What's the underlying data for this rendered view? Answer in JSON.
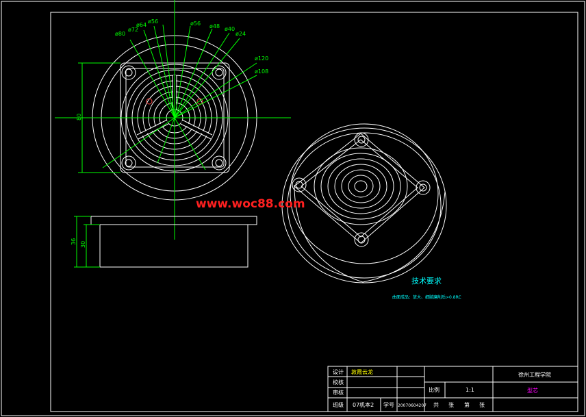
{
  "drawing": {
    "dimensions": {
      "d80": "ø80",
      "d72": "ø72",
      "d64": "ø64",
      "d56a": "ø56",
      "d56b": "ø56",
      "d48": "ø48",
      "d40": "ø40",
      "d24": "ø24",
      "d120": "ø120",
      "d108": "ø108",
      "h80": "80",
      "h36": "36",
      "h30": "30"
    },
    "watermark": "www.woc88.com",
    "tech_title": "技术要求",
    "tech_note": "曲面成品：放大、细腻磨削后>0.8RC"
  },
  "title_block": {
    "r1_label": "设计",
    "r1_value": "敦霞云龙",
    "r2_label": "校核",
    "r3_label": "审核",
    "r4_label": "班级",
    "r4_value": "07机本2",
    "r4_label2": "学号",
    "r4_value2": "20070604207",
    "scale_label": "比例",
    "scale_value": "1:1",
    "school": "徐州工程学院",
    "part_name": "型芯",
    "sheet_total": "共",
    "sheet_word": "张",
    "sheet_no": "第",
    "sheet_word2": "张"
  },
  "colors": {
    "geometry": "#ffffff",
    "dimension": "#00ff00",
    "watermark": "#ff2020",
    "note": "#00ffff",
    "title_text": "#ffff00"
  }
}
